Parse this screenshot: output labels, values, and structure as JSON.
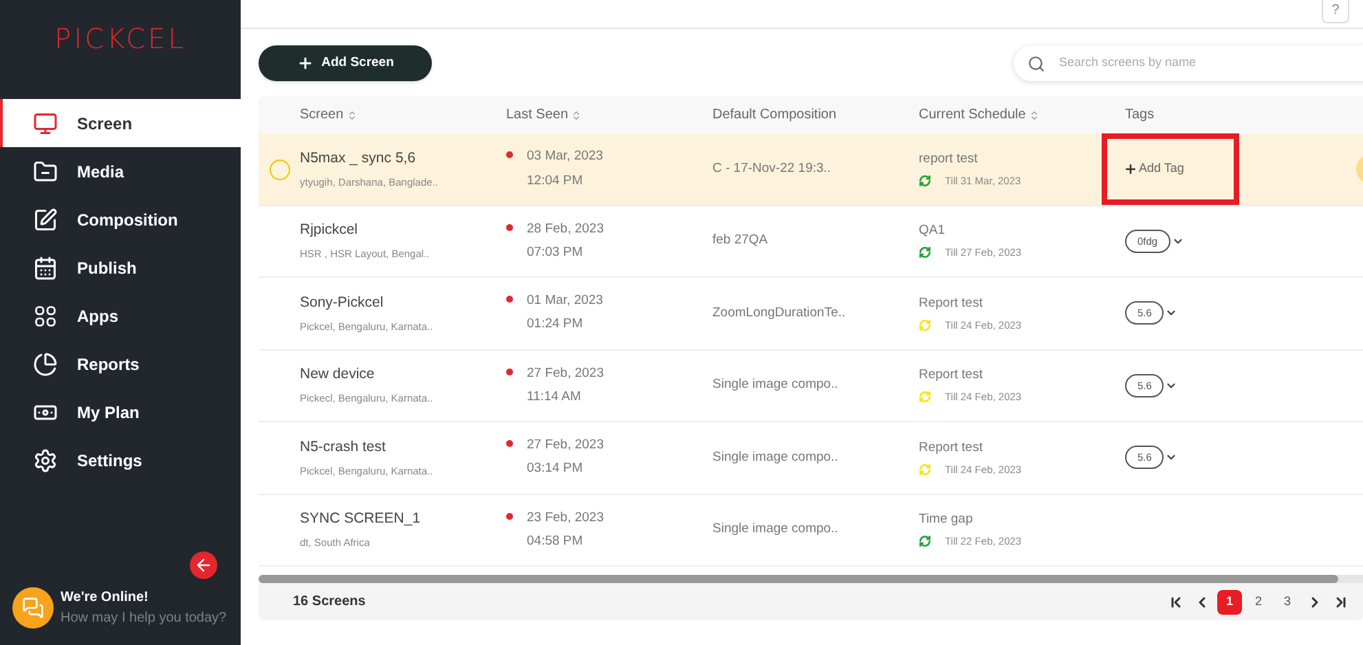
{
  "sidebar": {
    "logo": "PICKCEL",
    "items": [
      {
        "label": "Screen",
        "selected": true
      },
      {
        "label": "Media",
        "selected": false
      },
      {
        "label": "Composition",
        "selected": false
      },
      {
        "label": "Publish",
        "selected": false
      },
      {
        "label": "Apps",
        "selected": false
      },
      {
        "label": "Reports",
        "selected": false
      },
      {
        "label": "My Plan",
        "selected": false
      },
      {
        "label": "Settings",
        "selected": false
      }
    ],
    "chat": {
      "title": "We're Online!",
      "subtitle": "How may I help you today?"
    }
  },
  "topbar": {
    "help": "?"
  },
  "toolbar": {
    "add_button": "Add Screen",
    "search": {
      "placeholder": "Search screens by name"
    }
  },
  "table": {
    "columns": [
      {
        "label": "Screen",
        "sortable": true
      },
      {
        "label": "Last Seen",
        "sortable": true
      },
      {
        "label": "Default Composition",
        "sortable": false
      },
      {
        "label": "Current Schedule",
        "sortable": true
      },
      {
        "label": "Tags",
        "sortable": false
      }
    ],
    "rows": [
      {
        "selected": true,
        "name": "N5max _ sync 5,6",
        "location": "ytyugih, Darshana, Banglade..",
        "online": false,
        "date": "03 Mar, 2023",
        "time": "12:04 PM",
        "composition": "C - 17-Nov-22 19:3..",
        "schedule": "report test",
        "till": "Till 31 Mar, 2023",
        "color": "#22a33a",
        "tag": null,
        "add_tag": "Add Tag",
        "highlighted": true
      },
      {
        "selected": false,
        "name": "Rjpickcel",
        "location": "HSR , HSR Layout, Bengal..",
        "online": false,
        "date": "28 Feb, 2023",
        "time": "07:03 PM",
        "composition": "feb 27QA",
        "schedule": "QA1",
        "till": "Till 27 Feb, 2023",
        "color": "#22a33a",
        "tag": "0fdg"
      },
      {
        "selected": false,
        "name": "Sony-Pickcel",
        "location": "Pickcel, Bengaluru, Karnata..",
        "online": false,
        "date": "01 Mar, 2023",
        "time": "01:24 PM",
        "composition": "ZoomLongDurationTe..",
        "schedule": "Report test",
        "till": "Till 24 Feb, 2023",
        "color": "#f5e614",
        "tag": "5.6"
      },
      {
        "selected": false,
        "name": "New device",
        "location": "Pickecl, Bengaluru, Karnata..",
        "online": false,
        "date": "27 Feb, 2023",
        "time": "11:14 AM",
        "composition": "Single image compo..",
        "schedule": "Report test",
        "till": "Till 24 Feb, 2023",
        "color": "#f5e614",
        "tag": "5.6"
      },
      {
        "selected": false,
        "name": "N5-crash test",
        "location": "Pickcel, Bengaluru, Karnata..",
        "online": false,
        "date": "27 Feb, 2023",
        "time": "03:14 PM",
        "composition": "Single image compo..",
        "schedule": "Report test",
        "till": "Till 24 Feb, 2023",
        "color": "#f5e614",
        "tag": "5.6"
      },
      {
        "selected": false,
        "name": "SYNC SCREEN_1",
        "location": "dt, South Africa",
        "online": false,
        "date": "23 Feb, 2023",
        "time": "04:58 PM",
        "composition": "Single image compo..",
        "schedule": "Time gap",
        "till": "Till 22 Feb, 2023",
        "color": "#22a33a",
        "tag": null
      }
    ]
  },
  "footer": {
    "count": "16 Screens",
    "pages": [
      {
        "label": "1",
        "selected": true
      },
      {
        "label": "2",
        "selected": false
      },
      {
        "label": "3",
        "selected": false
      }
    ]
  }
}
